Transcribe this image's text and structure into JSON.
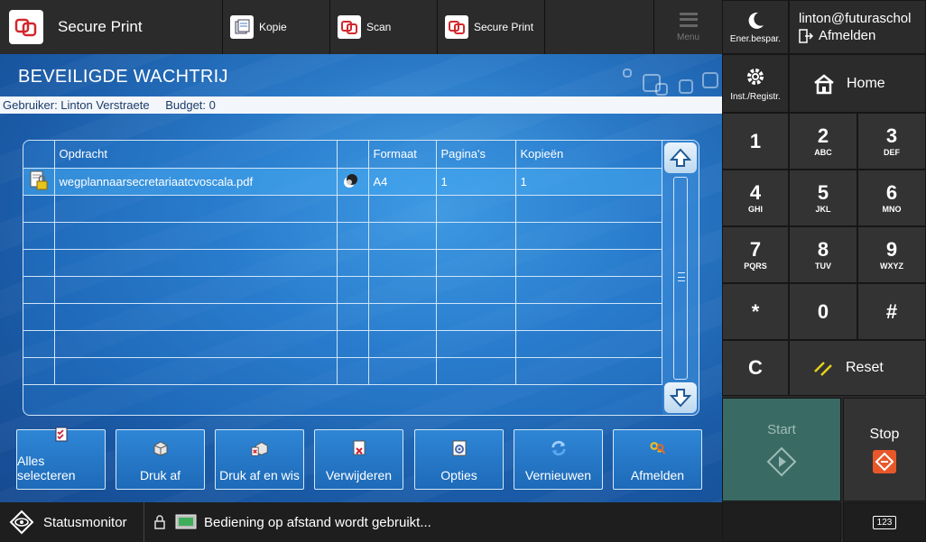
{
  "topbar": {
    "current_app": "Secure Print",
    "apps": [
      {
        "label": "Kopie",
        "icon": "copy-icon"
      },
      {
        "label": "Scan",
        "icon": "scan-icon"
      },
      {
        "label": "Secure Print",
        "icon": "secure-print-icon"
      }
    ],
    "menu_label": "Menu"
  },
  "page": {
    "title": "BEVEILIGDE WACHTRIJ",
    "user_label": "Gebruiker: Linton Verstraete",
    "budget_label": "Budget: 0"
  },
  "table": {
    "headers": [
      "Opdracht",
      "Formaat",
      "Pagina's",
      "Kopieën"
    ],
    "rows": [
      {
        "name": "wegplannaarsecretariaatcvoscala.pdf",
        "format": "A4",
        "pages": "1",
        "copies": "1"
      }
    ],
    "empty_rows": 7
  },
  "actions": [
    {
      "label": "Alles selecteren",
      "icon": "select-all-icon"
    },
    {
      "label": "Druk af",
      "icon": "print-icon"
    },
    {
      "label": "Druk af en wis",
      "icon": "print-delete-icon"
    },
    {
      "label": "Verwijderen",
      "icon": "delete-icon"
    },
    {
      "label": "Opties",
      "icon": "options-icon"
    },
    {
      "label": "Vernieuwen",
      "icon": "refresh-icon"
    },
    {
      "label": "Afmelden",
      "icon": "logout-icon"
    }
  ],
  "status": {
    "monitor_label": "Statusmonitor",
    "message": "Bediening op afstand wordt gebruikt..."
  },
  "right_panel": {
    "energy_label": "Ener.bespar.",
    "user_email": "linton@futuraschol",
    "logout_label": "Afmelden",
    "settings_label": "Inst./Registr.",
    "home_label": "Home",
    "keys": [
      {
        "num": "1",
        "sub": ""
      },
      {
        "num": "2",
        "sub": "ABC"
      },
      {
        "num": "3",
        "sub": "DEF"
      },
      {
        "num": "4",
        "sub": "GHI"
      },
      {
        "num": "5",
        "sub": "JKL"
      },
      {
        "num": "6",
        "sub": "MNO"
      },
      {
        "num": "7",
        "sub": "PQRS"
      },
      {
        "num": "8",
        "sub": "TUV"
      },
      {
        "num": "9",
        "sub": "WXYZ"
      },
      {
        "num": "*",
        "sub": ""
      },
      {
        "num": "0",
        "sub": ""
      },
      {
        "num": "#",
        "sub": ""
      }
    ],
    "clear_label": "C",
    "reset_label": "Reset",
    "start_label": "Start",
    "stop_label": "Stop",
    "counter_label": "123"
  },
  "colors": {
    "panel_blue": "#2a7ac8",
    "start_teal": "#3a6a64",
    "stop_orange": "#e8572a",
    "reset_yellow": "#e6d31a"
  }
}
